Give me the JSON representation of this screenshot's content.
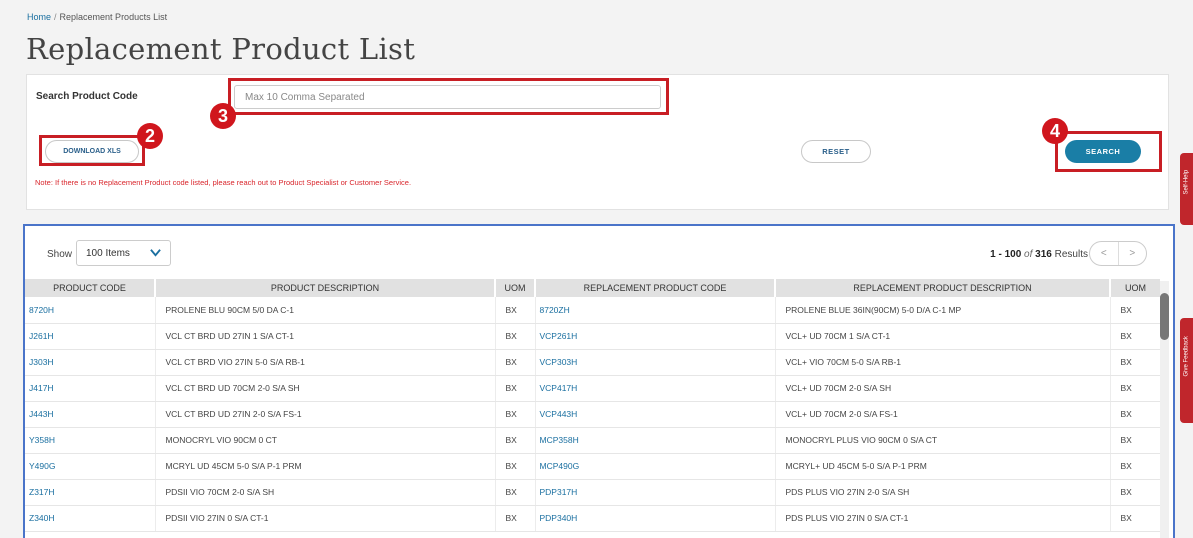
{
  "breadcrumb": {
    "home": "Home",
    "separator": "/",
    "current": "Replacement Products List"
  },
  "page_title": "Replacement Product List",
  "search": {
    "label": "Search Product Code",
    "placeholder": "Max 10 Comma Separated",
    "download_label": "DOWNLOAD XLS",
    "reset_label": "RESET",
    "search_label": "SEARCH",
    "note": "Note: If there is no Replacement Product code listed, please reach out to Product Specialist or Customer Service."
  },
  "markers": {
    "m2": "2",
    "m3": "3",
    "m4": "4"
  },
  "results": {
    "show_label": "Show",
    "show_value": "100 Items",
    "range": "1 - 100",
    "of": "of",
    "total": "316",
    "results_word": "Results",
    "prev": "<",
    "next": ">"
  },
  "table": {
    "headers": [
      "PRODUCT CODE",
      "PRODUCT DESCRIPTION",
      "UOM",
      "REPLACEMENT PRODUCT CODE",
      "REPLACEMENT PRODUCT DESCRIPTION",
      "UOM"
    ],
    "rows": [
      [
        "8720H",
        "PROLENE BLU 90CM 5/0 DA C-1",
        "BX",
        "8720ZH",
        "PROLENE BLUE 36IN(90CM) 5-0 D/A C-1 MP",
        "BX"
      ],
      [
        "J261H",
        "VCL CT BRD UD 27IN 1 S/A CT-1",
        "BX",
        "VCP261H",
        "VCL+ UD 70CM 1 S/A CT-1",
        "BX"
      ],
      [
        "J303H",
        "VCL CT BRD VIO 27IN 5-0 S/A RB-1",
        "BX",
        "VCP303H",
        "VCL+ VIO 70CM 5-0 S/A RB-1",
        "BX"
      ],
      [
        "J417H",
        "VCL CT BRD UD 70CM 2-0 S/A SH",
        "BX",
        "VCP417H",
        "VCL+ UD 70CM 2-0 S/A SH",
        "BX"
      ],
      [
        "J443H",
        "VCL CT BRD UD 27IN 2-0 S/A FS-1",
        "BX",
        "VCP443H",
        "VCL+ UD 70CM 2-0 S/A FS-1",
        "BX"
      ],
      [
        "Y358H",
        "MONOCRYL VIO 90CM 0 CT",
        "BX",
        "MCP358H",
        "MONOCRYL PLUS VIO 90CM 0 S/A CT",
        "BX"
      ],
      [
        "Y490G",
        "MCRYL UD 45CM 5-0 S/A P-1 PRM",
        "BX",
        "MCP490G",
        "MCRYL+ UD 45CM 5-0 S/A P-1 PRM",
        "BX"
      ],
      [
        "Z317H",
        "PDSII VIO 70CM 2-0 S/A SH",
        "BX",
        "PDP317H",
        "PDS PLUS VIO 27IN 2-0 S/A SH",
        "BX"
      ],
      [
        "Z340H",
        "PDSII VIO 27IN 0 S/A CT-1",
        "BX",
        "PDP340H",
        "PDS PLUS VIO 27IN 0 S/A CT-1",
        "BX"
      ]
    ]
  },
  "side_tabs": {
    "tab1": "Self-Help",
    "tab2": "Give Feedback"
  }
}
